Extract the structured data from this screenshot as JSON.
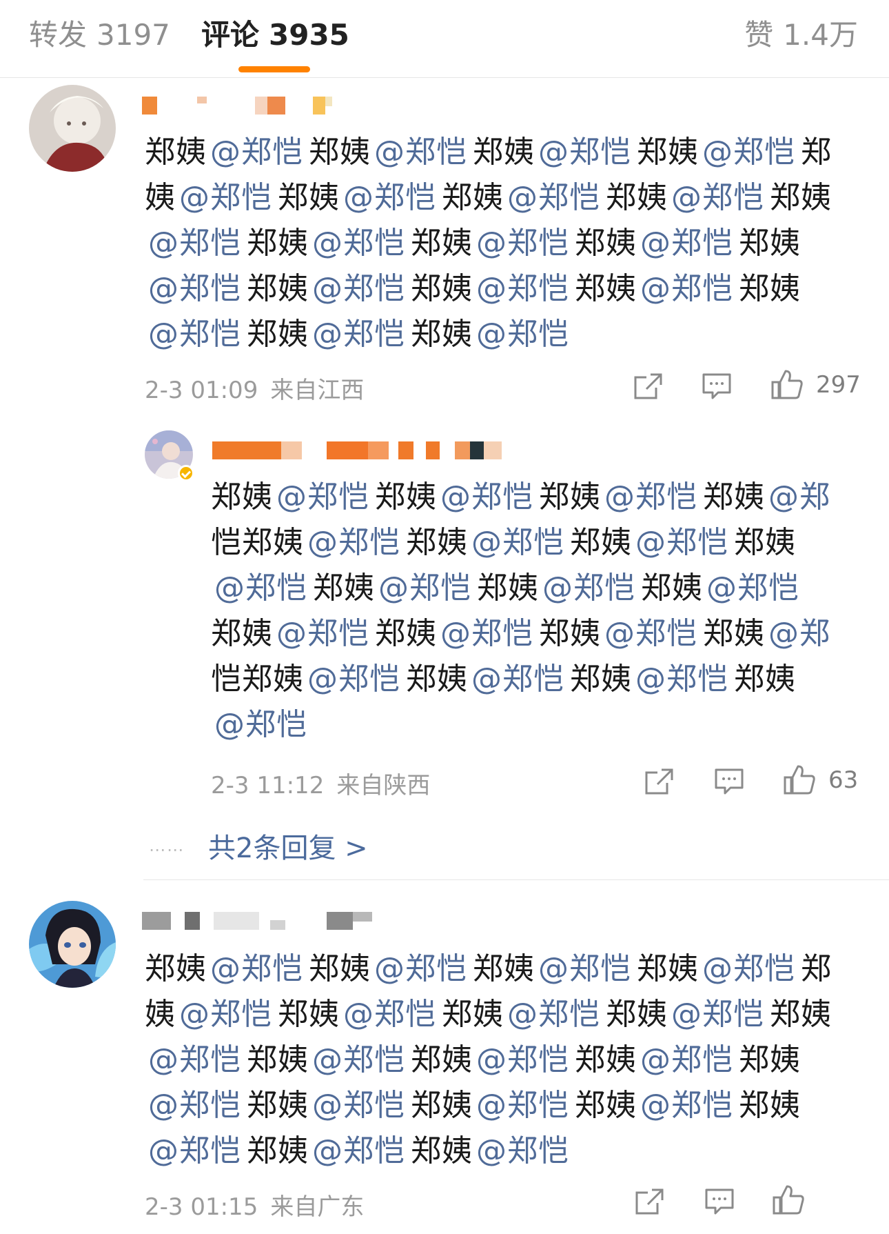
{
  "tabs": {
    "repost_label": "转发",
    "repost_count": "3197",
    "comment_label": "评论",
    "comment_count": "3935",
    "like_label": "赞",
    "like_count": "1.4万"
  },
  "comments": [
    {
      "body_lines": [
        [
          "郑姨",
          "@郑恺",
          "郑姨",
          "@郑恺",
          "郑姨",
          "@郑恺",
          "郑姨",
          "@郑恺",
          "郑"
        ],
        [
          "姨",
          "@郑恺",
          "郑姨",
          "@郑恺",
          "郑姨",
          "@郑恺",
          "郑姨",
          "@郑恺",
          "郑姨"
        ],
        [
          "@郑恺",
          "郑姨",
          "@郑恺",
          "郑姨",
          "@郑恺",
          "郑姨",
          "@郑恺",
          "郑姨"
        ],
        [
          "@郑恺",
          "郑姨",
          "@郑恺",
          "郑姨",
          "@郑恺",
          "郑姨",
          "@郑恺",
          "郑姨"
        ],
        [
          "@郑恺",
          "郑姨",
          "@郑恺",
          "郑姨",
          "@郑恺"
        ]
      ],
      "time": "2-3 01:09",
      "location": "来自江西",
      "likes": "297"
    },
    {
      "body_lines": [
        [
          "郑姨",
          "@郑恺",
          "郑姨",
          "@郑恺",
          "郑姨",
          "@郑恺",
          "郑姨",
          "@郑"
        ],
        [
          "恺",
          "郑姨",
          "@郑恺",
          "郑姨",
          "@郑恺",
          "郑姨",
          "@郑恺",
          "郑姨"
        ],
        [
          "@郑恺",
          "郑姨",
          "@郑恺",
          "郑姨",
          "@郑恺",
          "郑姨",
          "@郑恺"
        ],
        [
          "郑姨",
          "@郑恺",
          "郑姨",
          "@郑恺",
          "郑姨",
          "@郑恺",
          "郑姨",
          "@郑"
        ],
        [
          "恺",
          "郑姨",
          "@郑恺",
          "郑姨",
          "@郑恺",
          "郑姨",
          "@郑恺",
          "郑姨"
        ],
        [
          "@郑恺"
        ]
      ],
      "time": "2-3 11:12",
      "location": "来自陕西",
      "likes": "63"
    },
    {
      "body_lines": [
        [
          "郑姨",
          "@郑恺",
          "郑姨",
          "@郑恺",
          "郑姨",
          "@郑恺",
          "郑姨",
          "@郑恺",
          "郑"
        ],
        [
          "姨",
          "@郑恺",
          "郑姨",
          "@郑恺",
          "郑姨",
          "@郑恺",
          "郑姨",
          "@郑恺",
          "郑姨"
        ],
        [
          "@郑恺",
          "郑姨",
          "@郑恺",
          "郑姨",
          "@郑恺",
          "郑姨",
          "@郑恺",
          "郑姨"
        ],
        [
          "@郑恺",
          "郑姨",
          "@郑恺",
          "郑姨",
          "@郑恺",
          "郑姨",
          "@郑恺",
          "郑姨"
        ],
        [
          "@郑恺",
          "郑姨",
          "@郑恺",
          "郑姨",
          "@郑恺"
        ]
      ],
      "time": "2-3 01:15",
      "location": "来自广东"
    }
  ],
  "more_replies": {
    "label": "共2条回复 >"
  },
  "colors": {
    "accent": "#ff8200",
    "mention": "#506b98",
    "verified_badge": "#f7b500"
  },
  "icons": [
    "share-icon",
    "comment-icon",
    "like-icon"
  ]
}
